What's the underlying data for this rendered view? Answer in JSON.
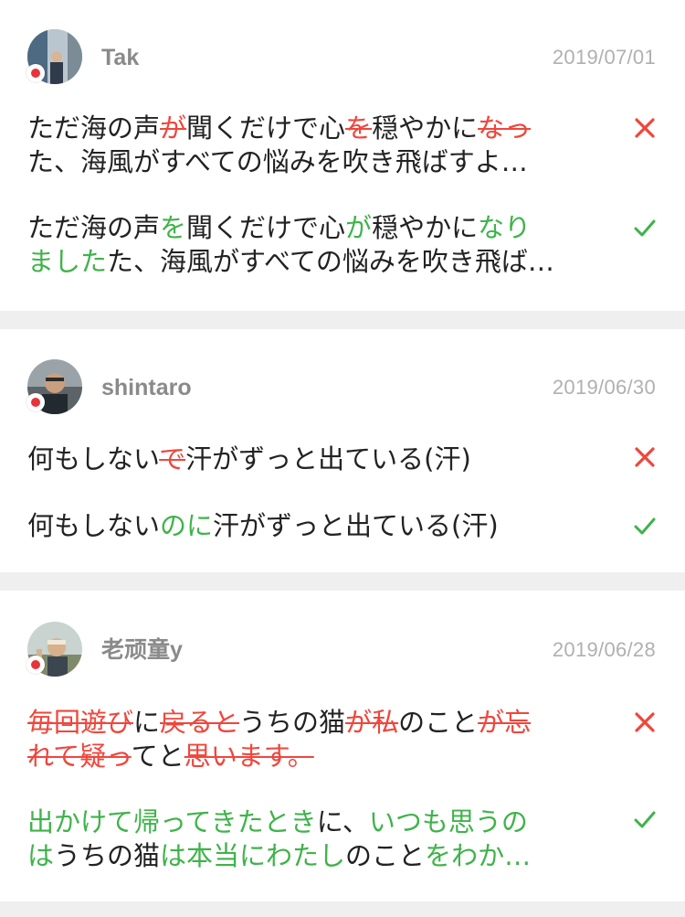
{
  "colors": {
    "wrong": "#f0463c",
    "correct": "#3fb34a",
    "text": "#222222",
    "meta": "#8a8a8a",
    "date": "#b0b0b0",
    "divider": "#efefef"
  },
  "posts": [
    {
      "username": "Tak",
      "date": "2019/07/01",
      "wrong_lines": [
        [
          "ただ海の声",
          "が",
          "聞くだけで心",
          "を",
          "穏やかに",
          "なっ"
        ],
        [
          "た、海風がすべての悩みを吹き飛ばすよ…"
        ]
      ],
      "correct_lines": [
        [
          "ただ海の声",
          "を",
          "聞くだけで心",
          "が",
          "穏やかに",
          "なり"
        ],
        [
          "ました",
          "た、海風がすべての悩みを吹き飛ば…"
        ]
      ]
    },
    {
      "username": "shintaro",
      "date": "2019/06/30",
      "wrong_lines": [
        [
          "何もしない",
          "で",
          "汗がずっと出ている(汗)"
        ]
      ],
      "correct_lines": [
        [
          "何もしない",
          "のに",
          "汗がずっと出ている(汗)"
        ]
      ]
    },
    {
      "username": "老顽童y",
      "date": "2019/06/28",
      "wrong_lines": [
        [
          "毎回遊び",
          "に",
          "戻ると",
          "うちの猫",
          "が私",
          "のこと",
          "が忘"
        ],
        [
          "れて疑っ",
          "てと",
          "思います。"
        ]
      ],
      "correct_lines": [
        [
          "出かけて帰ってきたとき",
          "に、",
          "いつも思うの"
        ],
        [
          "は",
          "うちの猫",
          "は本当にわたし",
          "のこと",
          "をわか…"
        ]
      ]
    }
  ],
  "icons": {
    "wrong": "cross-icon",
    "correct": "check-icon",
    "record": "record-dot-icon"
  }
}
